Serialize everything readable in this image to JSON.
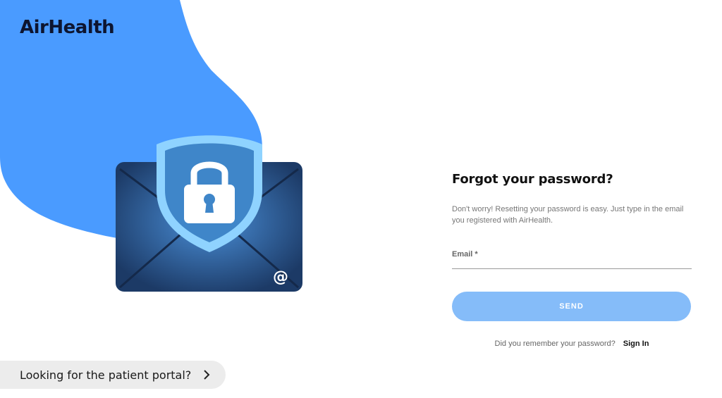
{
  "brand": {
    "name": "AirHealth"
  },
  "colors": {
    "accent": "#4a9bff",
    "button": "#85bcf9",
    "envelope": "#1c3a66",
    "shield": "#8fd3ff"
  },
  "illustration": {
    "at_symbol": "@"
  },
  "form": {
    "title": "Forgot your password?",
    "description": "Don't worry! Resetting your password is easy. Just type in the email you registered with AirHealth.",
    "email_label": "Email *",
    "email_value": "",
    "send_label": "SEND",
    "remember_text": "Did you remember your password?",
    "sign_in_label": "Sign In"
  },
  "portal": {
    "label": "Looking for the patient portal?",
    "icon": "chevron-right-icon"
  }
}
